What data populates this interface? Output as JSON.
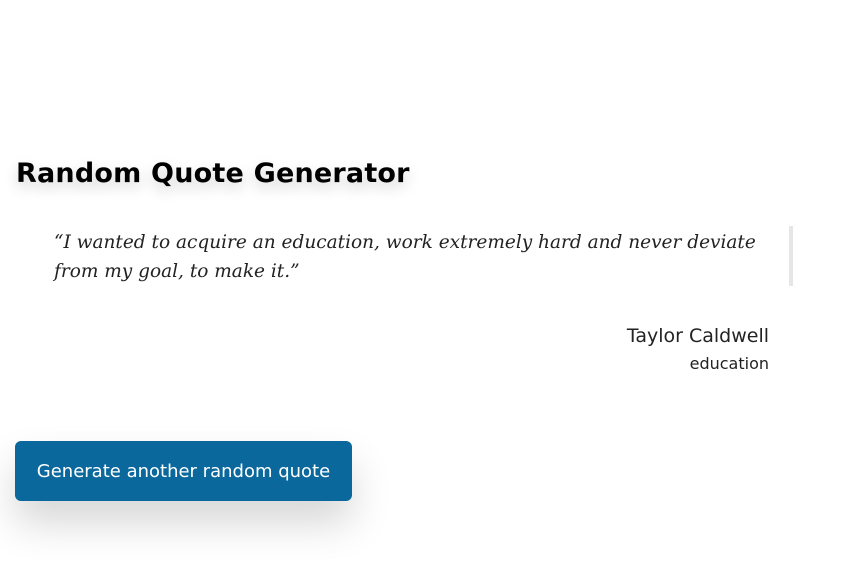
{
  "header": {
    "title": "Random Quote Generator"
  },
  "quote": {
    "text": "“I wanted to acquire an education, work extremely hard and never deviate from my goal, to make it.”",
    "author": "Taylor Caldwell",
    "category": "education"
  },
  "actions": {
    "generate_label": "Generate another random quote"
  },
  "colors": {
    "button_bg": "#0b689d",
    "quote_bar": "#e6e6e6"
  }
}
